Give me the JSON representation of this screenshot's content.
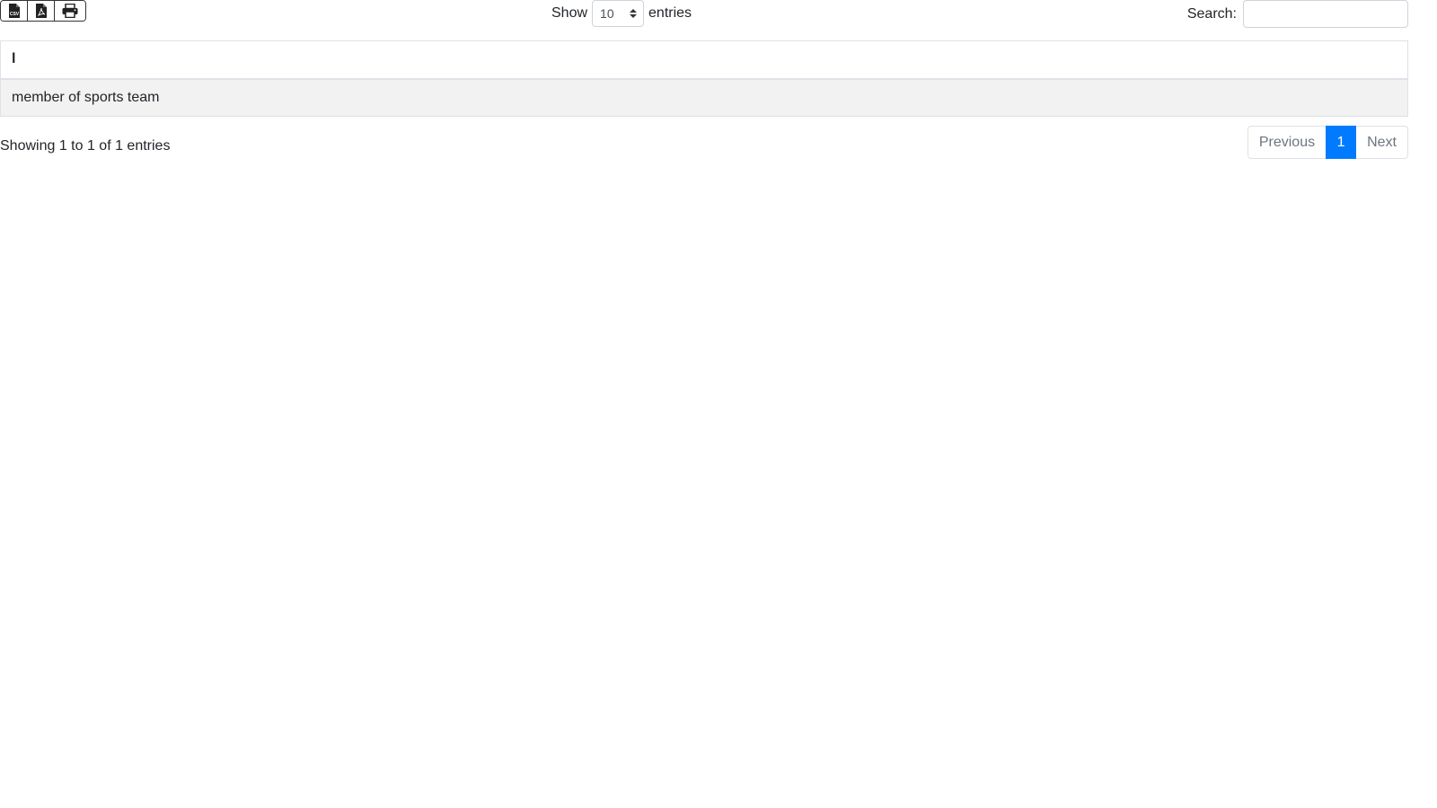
{
  "toolbar": {
    "export_buttons": [
      {
        "icon": "csv-file-icon"
      },
      {
        "icon": "pdf-file-icon"
      },
      {
        "icon": "print-icon"
      }
    ]
  },
  "length": {
    "show_label": "Show",
    "selected": "10",
    "entries_label": "entries"
  },
  "search": {
    "label": "Search:",
    "value": "",
    "placeholder": ""
  },
  "table": {
    "columns": [
      "l"
    ],
    "rows": [
      [
        "member of sports team"
      ]
    ]
  },
  "info": "Showing 1 to 1 of 1 entries",
  "pagination": {
    "previous": "Previous",
    "current": "1",
    "next": "Next",
    "active_color": "#007bff"
  }
}
